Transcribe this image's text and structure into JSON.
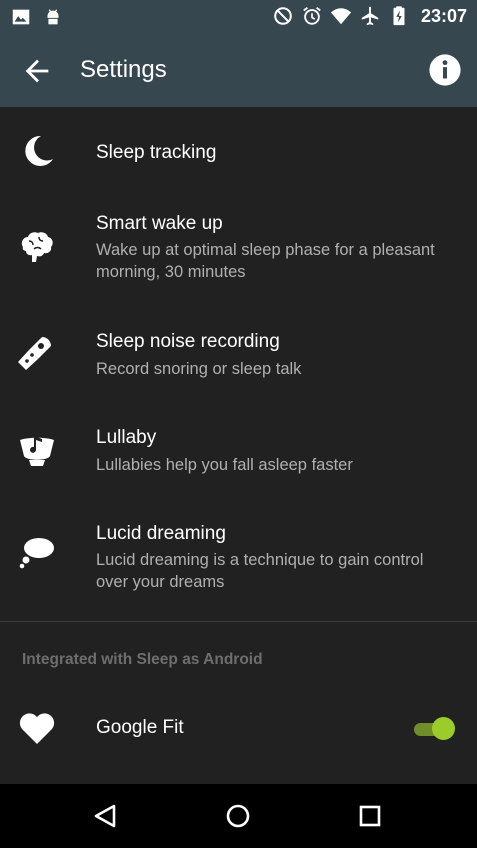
{
  "status_bar": {
    "time": "23:07",
    "left_icons": [
      "gallery-notification-icon",
      "android-notification-icon"
    ],
    "right_icons": [
      "do-not-disturb-icon",
      "alarm-icon",
      "wifi-icon",
      "airplane-icon",
      "battery-charging-icon"
    ]
  },
  "app_bar": {
    "title": "Settings",
    "back_icon": "arrow-back-icon",
    "info_icon": "info-icon"
  },
  "settings": [
    {
      "icon": "moon-icon",
      "title": "Sleep tracking",
      "subtitle": ""
    },
    {
      "icon": "brain-icon",
      "title": "Smart wake up",
      "subtitle": "Wake up at optimal sleep phase for a pleasant morning, 30 minutes"
    },
    {
      "icon": "microphone-icon",
      "title": "Sleep noise recording",
      "subtitle": "Record snoring or sleep talk"
    },
    {
      "icon": "lullaby-icon",
      "title": "Lullaby",
      "subtitle": "Lullabies help you fall asleep faster"
    },
    {
      "icon": "speech-bubble-icon",
      "title": "Lucid dreaming",
      "subtitle": "Lucid dreaming is a technique to gain control over your dreams"
    }
  ],
  "integration": {
    "section_title": "Integrated with Sleep as Android",
    "items": [
      {
        "icon": "heart-icon",
        "title": "Google Fit",
        "toggle_on": true
      }
    ]
  },
  "colors": {
    "app_bar": "#37474f",
    "background": "#212121",
    "accent": "#9ccc2c"
  },
  "nav_bar": {
    "icons": [
      "back-triangle-icon",
      "home-circle-icon",
      "recents-square-icon"
    ]
  }
}
